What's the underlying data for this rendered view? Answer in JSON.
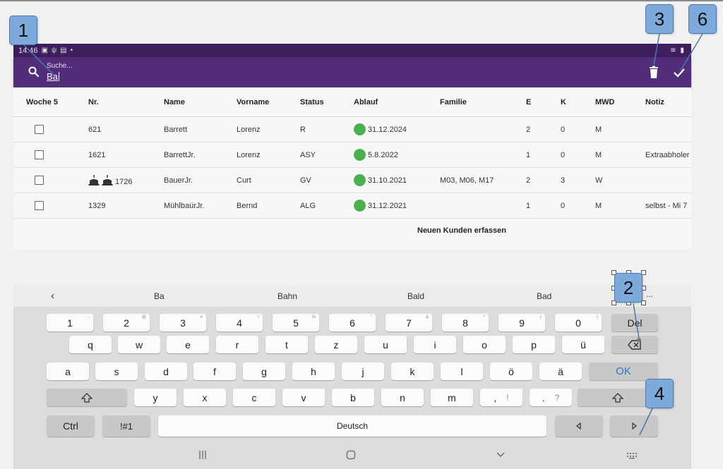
{
  "status_bar": {
    "time": "14:46"
  },
  "search": {
    "label": "Suche...",
    "value": "Ba"
  },
  "table": {
    "headers": [
      "Woche 5",
      "Nr.",
      "Name",
      "Vorname",
      "Status",
      "Ablauf",
      "Familie",
      "E",
      "K",
      "MWD",
      "Notiz"
    ],
    "rows": [
      {
        "nr": "621",
        "name": "Barrett",
        "vorname": "Lorenz",
        "status": "R",
        "ablauf": "31.12.2024",
        "familie": "",
        "e": "2",
        "k": "0",
        "mwd": "M",
        "notiz": ""
      },
      {
        "nr": "1621",
        "name": "BarrettJr.",
        "vorname": "Lorenz",
        "status": "ASY",
        "ablauf": "5.8.2022",
        "familie": "",
        "e": "1",
        "k": "0",
        "mwd": "M",
        "notiz": "Extraabholer"
      },
      {
        "nr": "1726",
        "name": "BauerJr.",
        "vorname": "Curt",
        "status": "GV",
        "ablauf": "31.10.2021",
        "familie": "M03, M06, M17",
        "e": "2",
        "k": "3",
        "mwd": "W",
        "notiz": ""
      },
      {
        "nr": "1329",
        "name": "MühlbaürJr.",
        "vorname": "Bernd",
        "status": "ALG",
        "ablauf": "31.12.2021",
        "familie": "",
        "e": "1",
        "k": "0",
        "mwd": "M",
        "notiz": "selbst - Mi 7"
      }
    ],
    "new_customer_label": "Neuen Kunden erfassen"
  },
  "keyboard": {
    "suggestions": [
      "Ba",
      "Bahn",
      "Bald",
      "Bad"
    ],
    "more": "...",
    "number_row": [
      {
        "k": "1",
        "s": "-"
      },
      {
        "k": "2",
        "s": "@"
      },
      {
        "k": "3",
        "s": "#"
      },
      {
        "k": "4",
        "s": "/"
      },
      {
        "k": "5",
        "s": "%"
      },
      {
        "k": "6",
        "s": "\""
      },
      {
        "k": "7",
        "s": "&"
      },
      {
        "k": "8",
        "s": "*"
      },
      {
        "k": "9",
        "s": "("
      },
      {
        "k": "0",
        "s": ")"
      }
    ],
    "del_label": "Del",
    "row2": [
      "q",
      "w",
      "e",
      "r",
      "t",
      "z",
      "u",
      "i",
      "o",
      "p",
      "ü"
    ],
    "row3": [
      "a",
      "s",
      "d",
      "f",
      "g",
      "h",
      "j",
      "k",
      "l",
      "ö",
      "ä"
    ],
    "ok_label": "OK",
    "row4": [
      "y",
      "x",
      "c",
      "v",
      "b",
      "n",
      "m"
    ],
    "comma_key": ",",
    "comma_sub": "!",
    "period_key": ".",
    "period_sub": "?",
    "ctrl_label": "Ctrl",
    "sym_label": "!#1",
    "space_label": "Deutsch"
  },
  "callouts": [
    "1",
    "2",
    "3",
    "4",
    "6"
  ],
  "colors": {
    "appbar": "#512d7a",
    "statusbar": "#3c1f5c",
    "green_dot": "#4caf50",
    "ok_key": "#2b74c9",
    "callout": "#7eaadb"
  }
}
